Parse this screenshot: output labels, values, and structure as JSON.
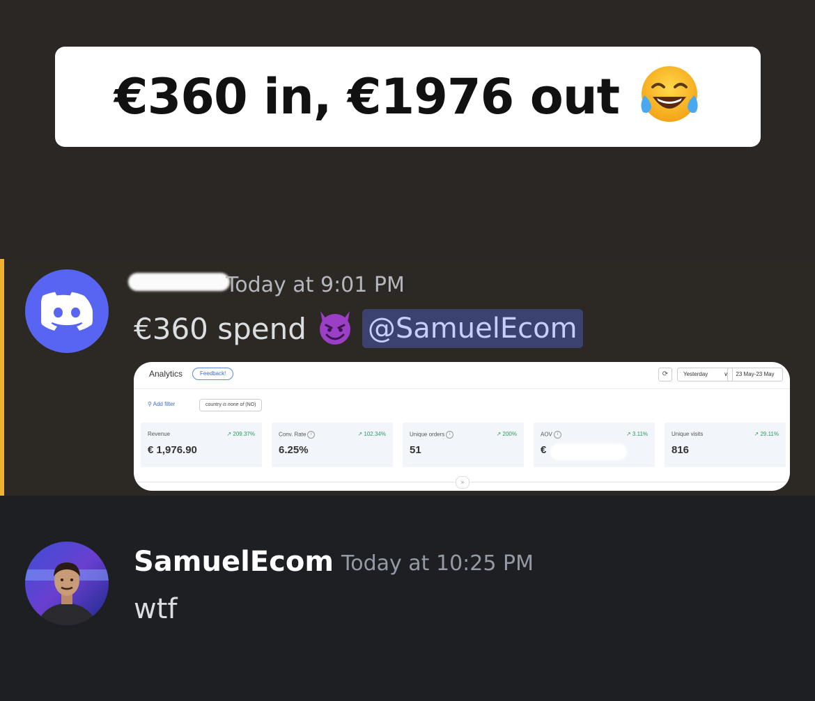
{
  "headline": {
    "text": "€360 in, €1976 out",
    "emoji": "face-with-tears-of-joy-emoji"
  },
  "messages": [
    {
      "author": "",
      "author_redacted": true,
      "avatar": "discord-logo-icon",
      "timestamp": "Today at 9:01 PM",
      "text": "€360 spend",
      "emoji": "smiling-imp-emoji",
      "mention": "@SamuelEcom",
      "highlight_color": "#f0b132",
      "embed": {
        "title": "Analytics",
        "feedback_label": "Feedback!",
        "refresh_icon": "refresh-icon",
        "period": "Yesterday",
        "date_range": "23 May-23 May",
        "add_filter_label": "Add filter",
        "filter_chip": {
          "field": "country",
          "operator": "is none of",
          "value": "(NO)"
        },
        "metrics": [
          {
            "label": "Revenue",
            "change": "↗ 209.37%",
            "value": "€ 1,976.90",
            "info": false
          },
          {
            "label": "Conv. Rate",
            "change": "↗ 102.34%",
            "value": "6.25%",
            "info": true
          },
          {
            "label": "Unique orders",
            "change": "↗ 200%",
            "value": "51",
            "info": true
          },
          {
            "label": "AOV",
            "change": "↗ 3.11%",
            "value": "€",
            "info": true,
            "redacted": true
          },
          {
            "label": "Unique visits",
            "change": "↗ 29.11%",
            "value": "816",
            "info": false
          }
        ]
      }
    },
    {
      "author": "SamuelEcom",
      "avatar": "user-photo-avatar",
      "timestamp": "Today at 10:25 PM",
      "text": "wtf"
    }
  ],
  "colors": {
    "discord_blurple": "#5865f2",
    "mention_bg": "#3c4270",
    "change_positive": "#2a9d5c"
  }
}
